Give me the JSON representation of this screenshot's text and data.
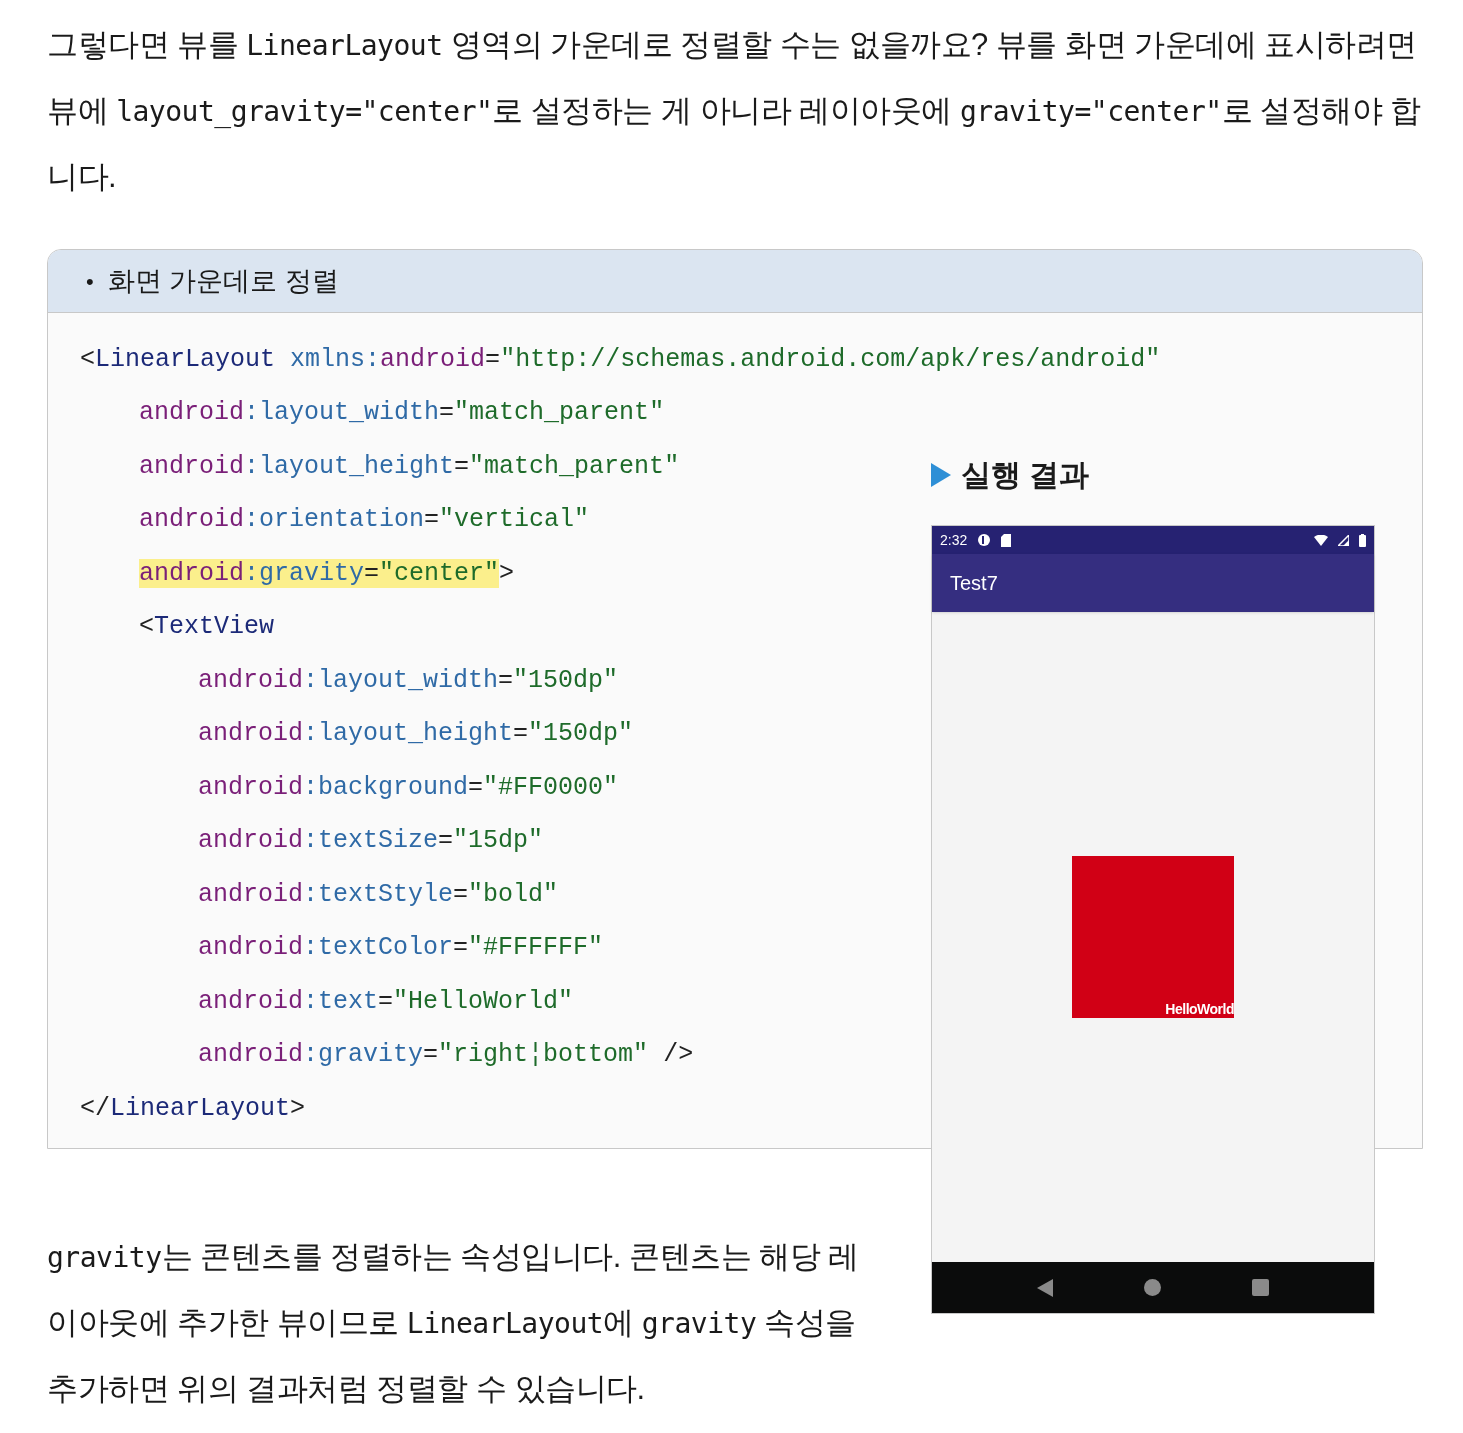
{
  "intro": {
    "segments": [
      {
        "kind": "text",
        "text": "그렇다면 뷰를 "
      },
      {
        "kind": "code",
        "text": "LinearLayout"
      },
      {
        "kind": "text",
        "text": " 영역의 가운데로 정렬할 수는 없을까요? 뷰를 화면 가운데에 표시하려면 뷰에 "
      },
      {
        "kind": "code",
        "text": "layout_gravity=\"center\""
      },
      {
        "kind": "text",
        "text": "로 설정하는 게 아니라 레이아웃에 "
      },
      {
        "kind": "code",
        "text": "gravity=\"center\""
      },
      {
        "kind": "text",
        "text": "로 설정해야 합니다."
      }
    ]
  },
  "code_box": {
    "bullet": "•",
    "title": "화면 가운데로 정렬",
    "lines": [
      {
        "highlighted": false,
        "tokens": [
          {
            "kind": "punct",
            "text": "<"
          },
          {
            "kind": "tag",
            "text": "LinearLayout"
          },
          {
            "kind": "attr",
            "text": " xmlns:"
          },
          {
            "kind": "ns",
            "text": "android"
          },
          {
            "kind": "punct",
            "text": "="
          },
          {
            "kind": "value",
            "text": "\"http://schemas.android.com/apk/res/android\""
          }
        ],
        "children": [
          {
            "highlighted": false,
            "tokens": [
              {
                "kind": "ns",
                "text": "android"
              },
              {
                "kind": "attr",
                "text": ":layout_width"
              },
              {
                "kind": "punct",
                "text": "="
              },
              {
                "kind": "value",
                "text": "\"match_parent\""
              }
            ]
          },
          {
            "highlighted": false,
            "tokens": [
              {
                "kind": "ns",
                "text": "android"
              },
              {
                "kind": "attr",
                "text": ":layout_height"
              },
              {
                "kind": "punct",
                "text": "="
              },
              {
                "kind": "value",
                "text": "\"match_parent\""
              }
            ]
          },
          {
            "highlighted": false,
            "tokens": [
              {
                "kind": "ns",
                "text": "android"
              },
              {
                "kind": "attr",
                "text": ":orientation"
              },
              {
                "kind": "punct",
                "text": "="
              },
              {
                "kind": "value",
                "text": "\"vertical\""
              }
            ]
          },
          {
            "highlighted": true,
            "tokens": [
              {
                "kind": "ns",
                "text": "android"
              },
              {
                "kind": "attr",
                "text": ":gravity"
              },
              {
                "kind": "punct",
                "text": "="
              },
              {
                "kind": "value",
                "text": "\"center\""
              },
              {
                "kind": "close",
                "text": ">"
              }
            ]
          },
          {
            "highlighted": false,
            "tokens": [
              {
                "kind": "punct",
                "text": "<"
              },
              {
                "kind": "tag",
                "text": "TextView"
              }
            ],
            "children": [
              {
                "highlighted": false,
                "tokens": [
                  {
                    "kind": "ns",
                    "text": "android"
                  },
                  {
                    "kind": "attr",
                    "text": ":layout_width"
                  },
                  {
                    "kind": "punct",
                    "text": "="
                  },
                  {
                    "kind": "value",
                    "text": "\"150dp\""
                  }
                ]
              },
              {
                "highlighted": false,
                "tokens": [
                  {
                    "kind": "ns",
                    "text": "android"
                  },
                  {
                    "kind": "attr",
                    "text": ":layout_height"
                  },
                  {
                    "kind": "punct",
                    "text": "="
                  },
                  {
                    "kind": "value",
                    "text": "\"150dp\""
                  }
                ]
              },
              {
                "highlighted": false,
                "tokens": [
                  {
                    "kind": "ns",
                    "text": "android"
                  },
                  {
                    "kind": "attr",
                    "text": ":background"
                  },
                  {
                    "kind": "punct",
                    "text": "="
                  },
                  {
                    "kind": "value",
                    "text": "\"#FF0000\""
                  }
                ]
              },
              {
                "highlighted": false,
                "tokens": [
                  {
                    "kind": "ns",
                    "text": "android"
                  },
                  {
                    "kind": "attr",
                    "text": ":textSize"
                  },
                  {
                    "kind": "punct",
                    "text": "="
                  },
                  {
                    "kind": "value",
                    "text": "\"15dp\""
                  }
                ]
              },
              {
                "highlighted": false,
                "tokens": [
                  {
                    "kind": "ns",
                    "text": "android"
                  },
                  {
                    "kind": "attr",
                    "text": ":textStyle"
                  },
                  {
                    "kind": "punct",
                    "text": "="
                  },
                  {
                    "kind": "value",
                    "text": "\"bold\""
                  }
                ]
              },
              {
                "highlighted": false,
                "tokens": [
                  {
                    "kind": "ns",
                    "text": "android"
                  },
                  {
                    "kind": "attr",
                    "text": ":textColor"
                  },
                  {
                    "kind": "punct",
                    "text": "="
                  },
                  {
                    "kind": "value",
                    "text": "\"#FFFFFF\""
                  }
                ]
              },
              {
                "highlighted": false,
                "tokens": [
                  {
                    "kind": "ns",
                    "text": "android"
                  },
                  {
                    "kind": "attr",
                    "text": ":text"
                  },
                  {
                    "kind": "punct",
                    "text": "="
                  },
                  {
                    "kind": "value",
                    "text": "\"HelloWorld\""
                  }
                ]
              },
              {
                "highlighted": false,
                "tokens": [
                  {
                    "kind": "ns",
                    "text": "android"
                  },
                  {
                    "kind": "attr",
                    "text": ":gravity"
                  },
                  {
                    "kind": "punct",
                    "text": "="
                  },
                  {
                    "kind": "value",
                    "text": "\"right¦bottom\""
                  },
                  {
                    "kind": "close",
                    "text": " />"
                  }
                ]
              }
            ]
          }
        ]
      },
      {
        "highlighted": false,
        "tokens": [
          {
            "kind": "punct",
            "text": "</"
          },
          {
            "kind": "tag",
            "text": "LinearLayout"
          },
          {
            "kind": "punct",
            "text": ">"
          }
        ]
      }
    ]
  },
  "result": {
    "heading": "실행 결과",
    "phone": {
      "time": "2:32",
      "app_title": "Test7",
      "view_text": "HelloWorld"
    }
  },
  "outro": {
    "segments": [
      {
        "kind": "code",
        "text": "gravity"
      },
      {
        "kind": "text",
        "text": "는 콘텐츠를 정렬하는 속성입니다. 콘텐츠는 해당 레이아웃에 추가한 뷰이므로 "
      },
      {
        "kind": "code",
        "text": "LinearLayout"
      },
      {
        "kind": "text",
        "text": "에 "
      },
      {
        "kind": "code",
        "text": "gravity"
      },
      {
        "kind": "text",
        "text": " 속성을 추가하면 위의 결과처럼 정렬할 수 있습니다."
      }
    ]
  }
}
